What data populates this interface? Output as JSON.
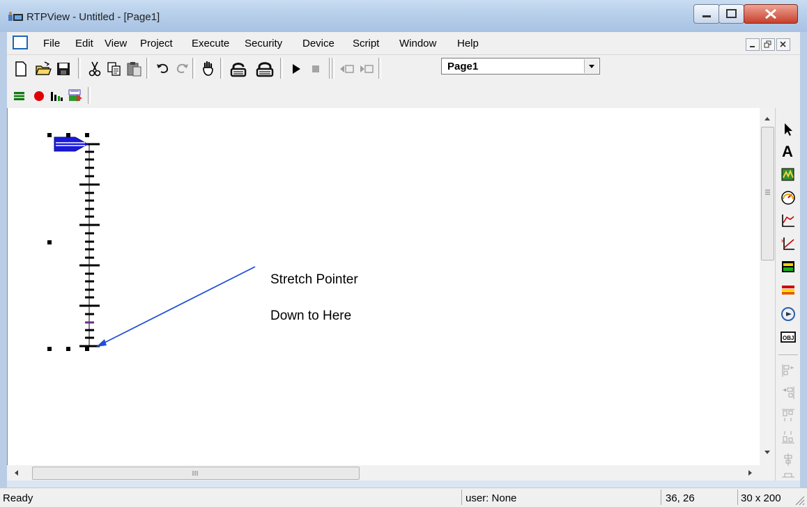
{
  "window": {
    "title": "RTPView  -  Untitled - [Page1]"
  },
  "menubar": {
    "items": [
      "File",
      "Edit",
      "View",
      "Project",
      "Execute",
      "Security",
      "Device",
      "Script",
      "Window",
      "Help"
    ]
  },
  "toolbar": {
    "page_select_value": "Page1"
  },
  "canvas": {
    "annotation_line1": "Stretch Pointer",
    "annotation_line2": "Down to Here"
  },
  "statusbar": {
    "status": "Ready",
    "user": "user: None",
    "position": "36, 26",
    "size": "30 x 200"
  },
  "colors": {
    "accent": "#1f4fd6",
    "pointer_blue": "#1a1adc",
    "record_red": "#e00000"
  },
  "icons": [
    "new-file-icon",
    "open-folder-icon",
    "save-icon",
    "cut-icon",
    "copy-icon",
    "paste-icon",
    "undo-icon",
    "redo-icon",
    "hand-icon",
    "lock-open-icon",
    "lock-icon",
    "run-icon",
    "stop-icon",
    "prev-page-icon",
    "next-page-icon",
    "pointer-arrow-icon",
    "text-tool-icon",
    "bitmap-tool-icon",
    "gauge-tool-icon",
    "chart-tool-icon",
    "xy-plot-tool-icon",
    "bar-indicator-icon",
    "multi-bar-icon",
    "dial-tool-icon",
    "object-tool-icon",
    "align-left-icon",
    "align-right-icon",
    "align-top-icon",
    "align-bottom-icon",
    "center-icon",
    "distribute-icon"
  ]
}
